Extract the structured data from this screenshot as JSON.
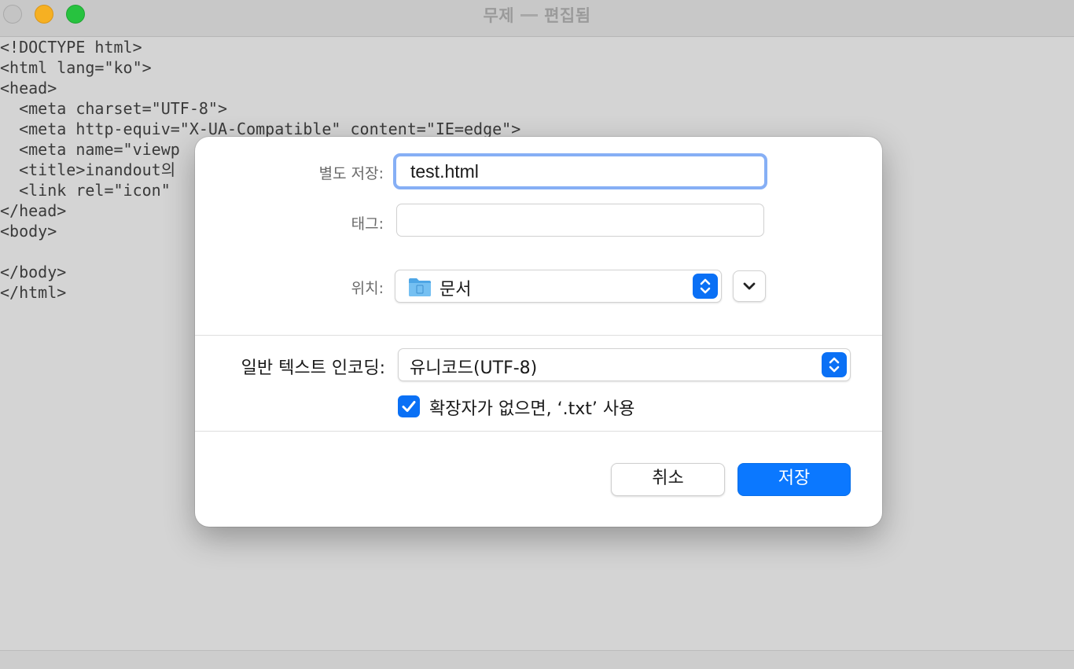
{
  "window": {
    "title": "무제",
    "status": "편집됨"
  },
  "editor": {
    "lines": [
      "<!DOCTYPE html>",
      "<html lang=\"ko\">",
      "<head>",
      "  <meta charset=\"UTF-8\">",
      "  <meta http-equiv=\"X-UA-Compatible\" content=\"IE=edge\">",
      "  <meta name=\"viewp",
      "  <title>inandout의",
      "  <link rel=\"icon\"",
      "</head>",
      "<body>",
      "",
      "</body>",
      "</html>"
    ]
  },
  "dialog": {
    "save_as_label": "별도 저장:",
    "save_as_value": "test.html",
    "tags_label": "태그:",
    "tags_value": "",
    "location_label": "위치:",
    "location_value": "문서",
    "encoding_label": "일반 텍스트 인코딩:",
    "encoding_value": "유니코드(UTF-8)",
    "extension_checkbox_label": "확장자가 없으면, ‘.txt’ 사용",
    "extension_checkbox_checked": true,
    "cancel_label": "취소",
    "save_label": "저장"
  },
  "colors": {
    "accent": "#0a70f5",
    "focus_ring": "#86aff5",
    "primary_button": "#0b78ff",
    "folder": "#5aaee8"
  },
  "icons": {
    "location_folder": "folder-icon",
    "location_stepper": "up-down-chevron-icon",
    "expand": "chevron-down-icon",
    "checkbox": "checkmark-icon"
  }
}
